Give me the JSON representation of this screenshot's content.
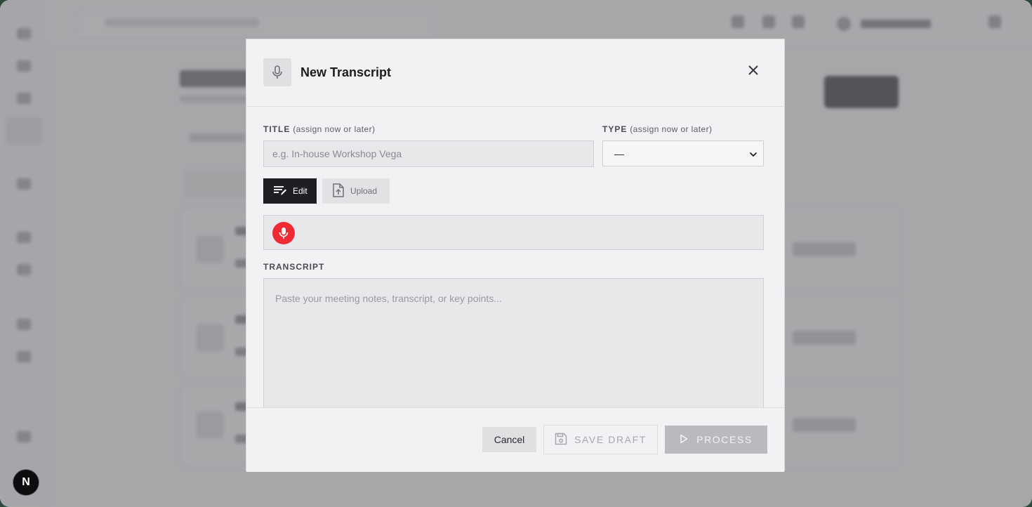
{
  "modal": {
    "title": "New Transcript",
    "title_field": {
      "label": "TITLE",
      "hint": "(assign now or later)",
      "placeholder": "e.g. In-house Workshop Vega",
      "value": ""
    },
    "type_field": {
      "label": "TYPE",
      "hint": "(assign now or later)",
      "selected": "—"
    },
    "modes": {
      "edit_label": "Edit",
      "upload_label": "Upload",
      "active": "edit"
    },
    "transcript": {
      "label": "TRANSCRIPT",
      "placeholder": "Paste your meeting notes, transcript, or key points..."
    },
    "footer": {
      "cancel_label": "Cancel",
      "save_draft_label": "SAVE DRAFT",
      "process_label": "PROCESS"
    }
  },
  "badge": {
    "letter": "N"
  },
  "colors": {
    "mic_button": "#ef2b34",
    "active_mode": "#1d1f23",
    "disabled_button": "#b9b9be"
  }
}
